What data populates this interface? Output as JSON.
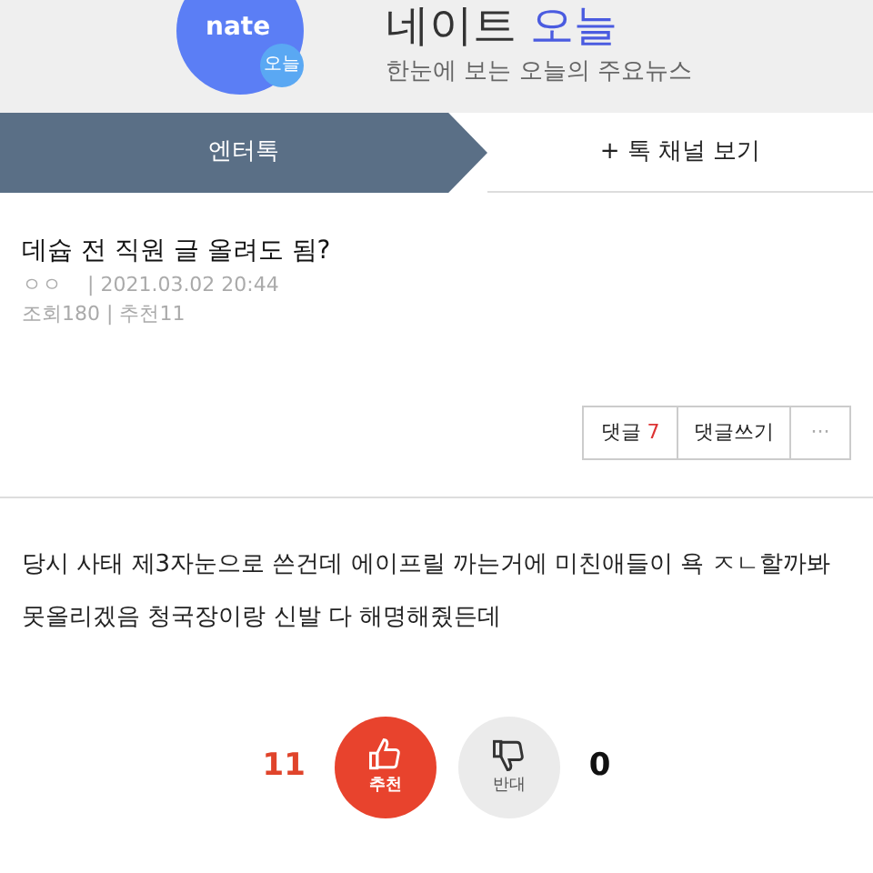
{
  "header": {
    "logo_text": "nate",
    "logo_badge": "오늘",
    "title_part1": "네이트",
    "title_part2": "오늘",
    "subtitle": "한눈에 보는 오늘의 주요뉴스"
  },
  "tabs": [
    {
      "label": "엔터톡",
      "selected": true
    },
    {
      "label": "+ 톡 채널 보기",
      "selected": false
    }
  ],
  "post": {
    "title": "데슙 전 직원 글 올려도 됨?",
    "author": "ㅇㅇ",
    "datetime": "| 2021.03.02 20:44",
    "stats": "조회180 | 추천11"
  },
  "actions": {
    "comments_label": "댓글",
    "comments_count": "7",
    "write_comment": "댓글쓰기",
    "more": "···"
  },
  "body": "당시 사태 제3자눈으로 쓴건데 에이프릴 까는거에 미친애들이 욕 ㅈㄴ할까봐 못올리겠음 청국장이랑 신발 다 해명해줬든데",
  "votes": {
    "up_count": "11",
    "up_label": "추천",
    "down_label": "반대",
    "down_count": "0"
  }
}
